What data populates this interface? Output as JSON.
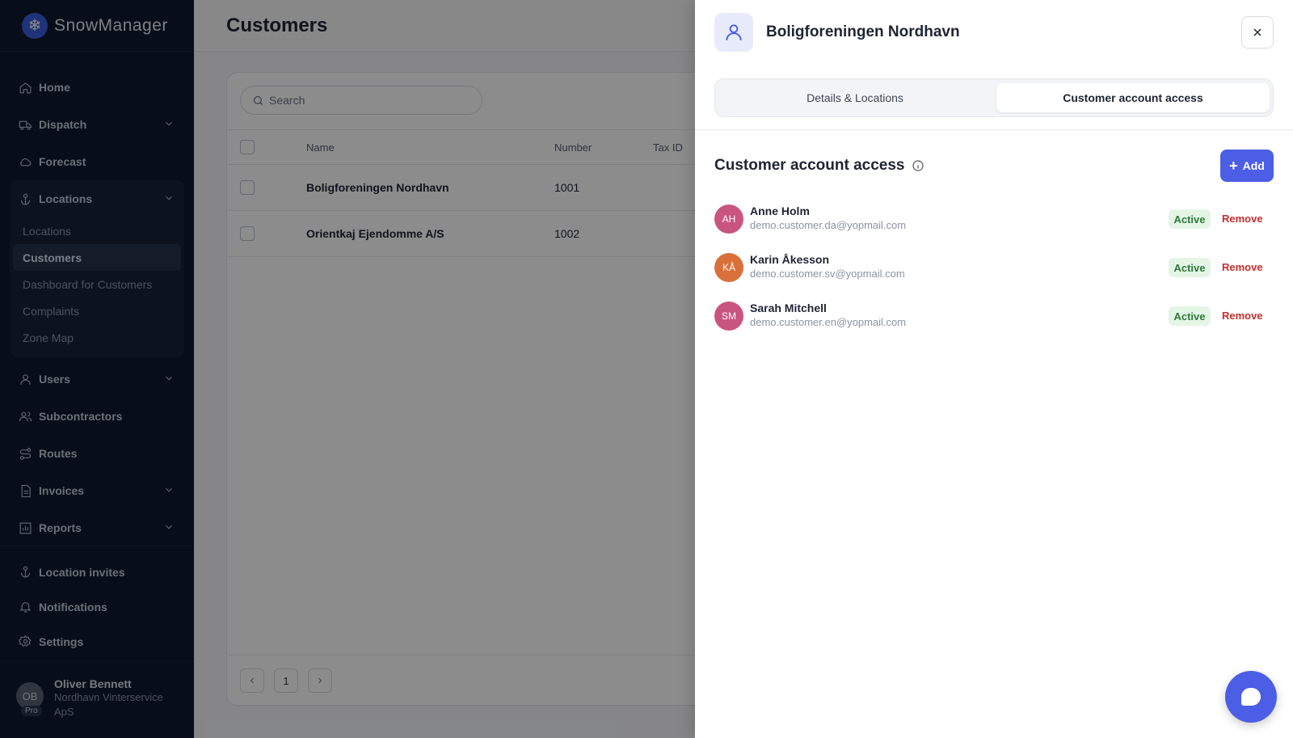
{
  "brand": {
    "name": "SnowManager"
  },
  "nav": {
    "home": "Home",
    "dispatch": "Dispatch",
    "forecast": "Forecast",
    "locations": "Locations",
    "locations_sub": [
      "Locations",
      "Customers",
      "Dashboard for Customers",
      "Complaints",
      "Zone Map"
    ],
    "users": "Users",
    "subcontractors": "Subcontractors",
    "routes": "Routes",
    "invoices": "Invoices",
    "reports": "Reports",
    "location_invites": "Location invites",
    "notifications": "Notifications",
    "settings": "Settings"
  },
  "user": {
    "initials": "OB",
    "badge": "Pro",
    "name": "Oliver Bennett",
    "org": "Nordhavn Vinterservice ApS"
  },
  "page": {
    "title": "Customers",
    "search_placeholder": "Search",
    "columns": {
      "name": "Name",
      "number": "Number",
      "tax_id": "Tax ID"
    },
    "rows": [
      {
        "name": "Boligforeningen Nordhavn",
        "number": "1001"
      },
      {
        "name": "Orientkaj Ejendomme A/S",
        "number": "1002"
      }
    ],
    "pager": {
      "page": "1"
    }
  },
  "drawer": {
    "title": "Boligforeningen Nordhavn",
    "tabs": {
      "details": "Details & Locations",
      "access": "Customer account access"
    },
    "section_title": "Customer account access",
    "add_label": "Add",
    "accounts": [
      {
        "initials": "AH",
        "name": "Anne Holm",
        "email": "demo.customer.da@yopmail.com",
        "status": "Active",
        "action": "Remove",
        "color": "#c9557f"
      },
      {
        "initials": "KÅ",
        "name": "Karin Åkesson",
        "email": "demo.customer.sv@yopmail.com",
        "status": "Active",
        "action": "Remove",
        "color": "#d9703b"
      },
      {
        "initials": "SM",
        "name": "Sarah Mitchell",
        "email": "demo.customer.en@yopmail.com",
        "status": "Active",
        "action": "Remove",
        "color": "#c9557f"
      }
    ]
  },
  "colors": {
    "accent": "#4c5ee6",
    "sidebar": "#0f1a2e",
    "active_badge": "#2d7a3a",
    "remove": "#c32f2f"
  }
}
